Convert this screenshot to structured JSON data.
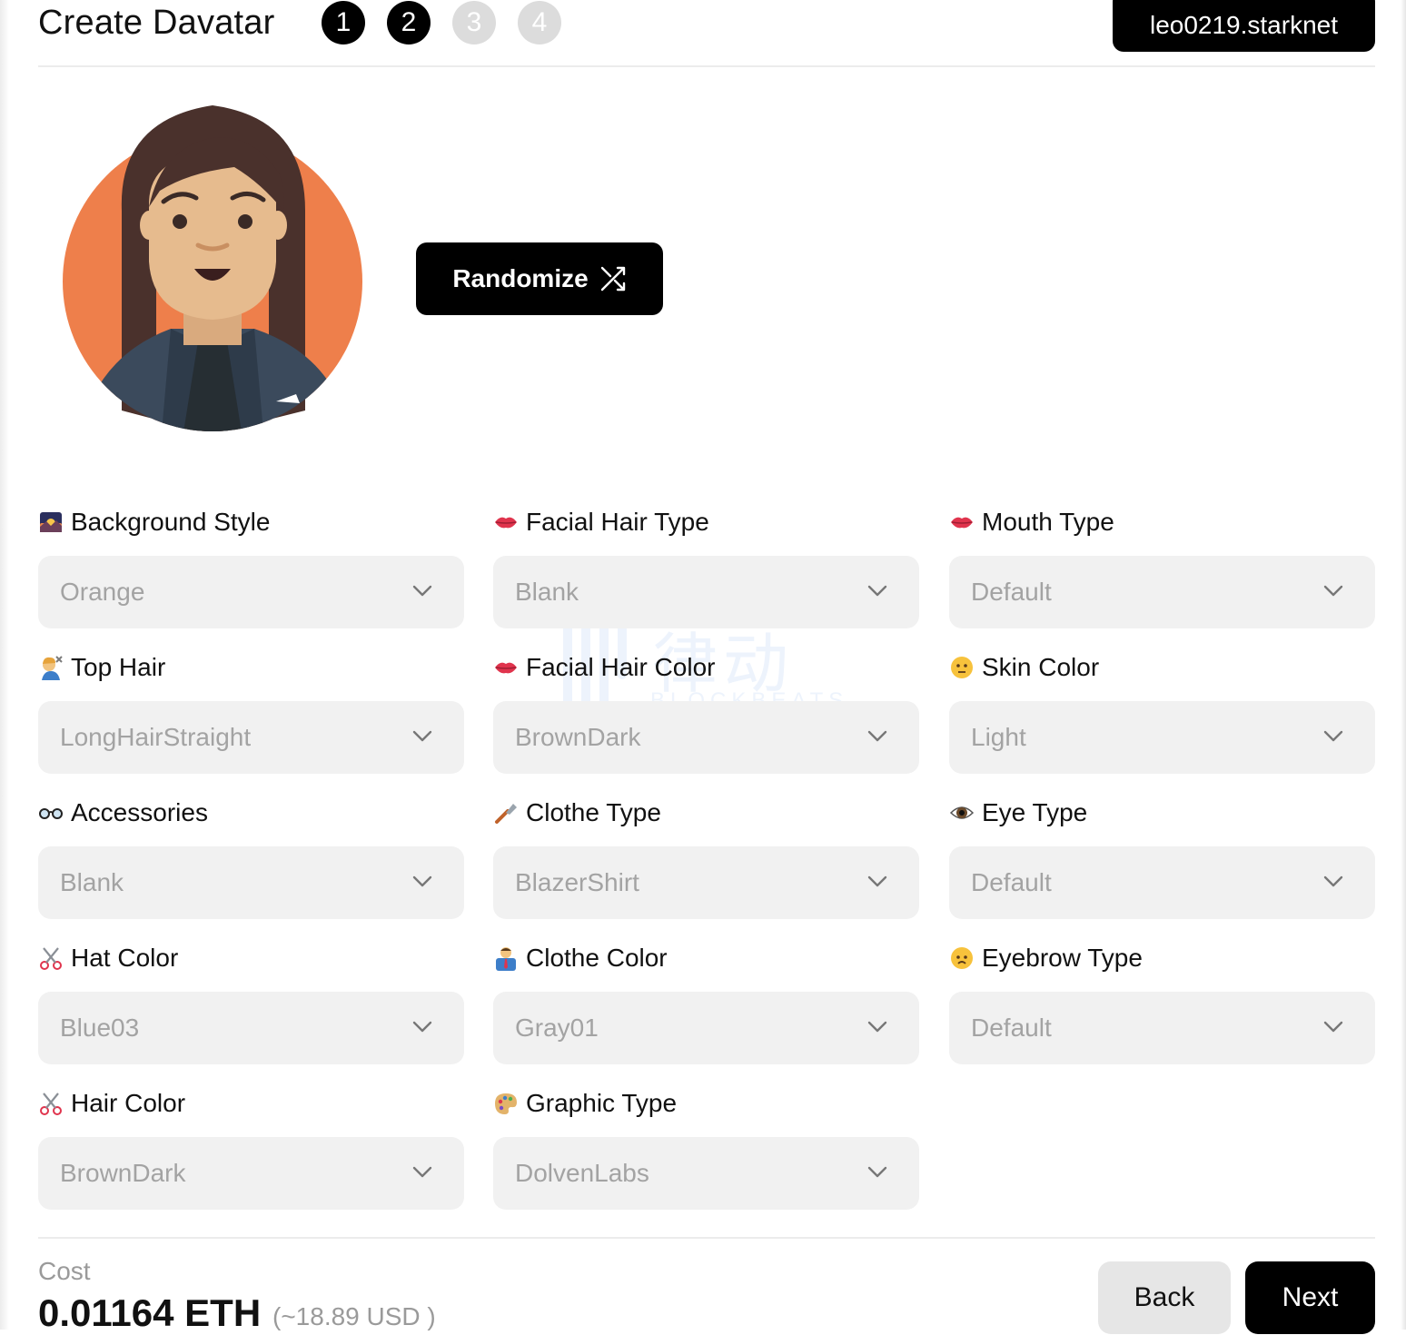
{
  "header": {
    "title": "Create Davatar",
    "steps": [
      "1",
      "2",
      "3",
      "4"
    ],
    "active_steps": 2,
    "wallet_label": "leo0219.starknet"
  },
  "avatar": {
    "randomize_label": "Randomize"
  },
  "fields": [
    {
      "label": "Background Style",
      "value": "Orange",
      "icon": "sunset-icon"
    },
    {
      "label": "Facial Hair Type",
      "value": "Blank",
      "icon": "lips-icon"
    },
    {
      "label": "Mouth Type",
      "value": "Default",
      "icon": "lips-icon"
    },
    {
      "label": "Top Hair",
      "value": "LongHairStraight",
      "icon": "haircut-person-icon"
    },
    {
      "label": "Facial Hair Color",
      "value": "BrownDark",
      "icon": "lips-icon"
    },
    {
      "label": "Skin Color",
      "value": "Light",
      "icon": "neutral-face-icon"
    },
    {
      "label": "Accessories",
      "value": "Blank",
      "icon": "glasses-icon"
    },
    {
      "label": "Clothe Type",
      "value": "BlazerShirt",
      "icon": "razor-icon"
    },
    {
      "label": "Eye Type",
      "value": "Default",
      "icon": "eye-icon"
    },
    {
      "label": "Hat Color",
      "value": "Blue03",
      "icon": "scissors-icon"
    },
    {
      "label": "Clothe Color",
      "value": "Gray01",
      "icon": "office-worker-icon"
    },
    {
      "label": "Eyebrow Type",
      "value": "Default",
      "icon": "worried-face-icon"
    },
    {
      "label": "Hair Color",
      "value": "BrownDark",
      "icon": "scissors-icon"
    },
    {
      "label": "Graphic Type",
      "value": "DolvenLabs",
      "icon": "palette-icon"
    }
  ],
  "watermark": {
    "text_cn": "律动",
    "text_en": "BLOCKBEATS"
  },
  "footer": {
    "cost_label": "Cost",
    "cost_value": "0.01164 ETH",
    "cost_usd": "(~18.89 USD )",
    "back_label": "Back",
    "next_label": "Next"
  },
  "colors": {
    "accent": "#000000",
    "avatar_background": "#ee7f4b",
    "select_background": "#f1f1f1",
    "placeholder_text": "#a3a3a3"
  }
}
